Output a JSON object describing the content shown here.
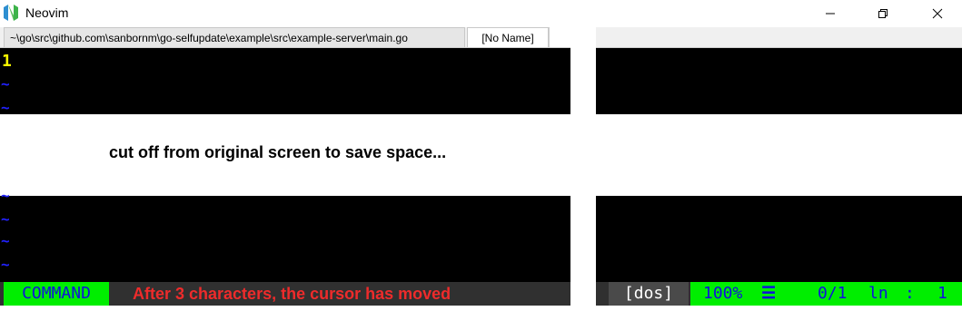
{
  "window": {
    "title": "Neovim",
    "logo_letter": "N",
    "controls": [
      "minimize",
      "maximize",
      "close"
    ]
  },
  "tabs": [
    {
      "label": "~\\go\\src\\github.com\\sanbornm\\go-selfupdate\\example\\src\\example-server\\main.go"
    },
    {
      "label": "[No Name]"
    }
  ],
  "editor": {
    "line_number": "1",
    "tilde": "~"
  },
  "note": "cut off from original screen to save space...",
  "statusline": {
    "mode": "COMMAND",
    "message": "After 3 characters, the cursor has moved",
    "fileformat": "[dos]",
    "percent": "100%",
    "bars": "☰",
    "lines": "0/1",
    "ln_label": "ln",
    "colon": ":",
    "col": "1"
  },
  "colors": {
    "mode_bg": "#00ee00",
    "mode_fg": "#1010dd",
    "message_fg": "#ee2b2b",
    "line_number_fg": "#ffff00",
    "tilde_fg": "#2222ff"
  }
}
